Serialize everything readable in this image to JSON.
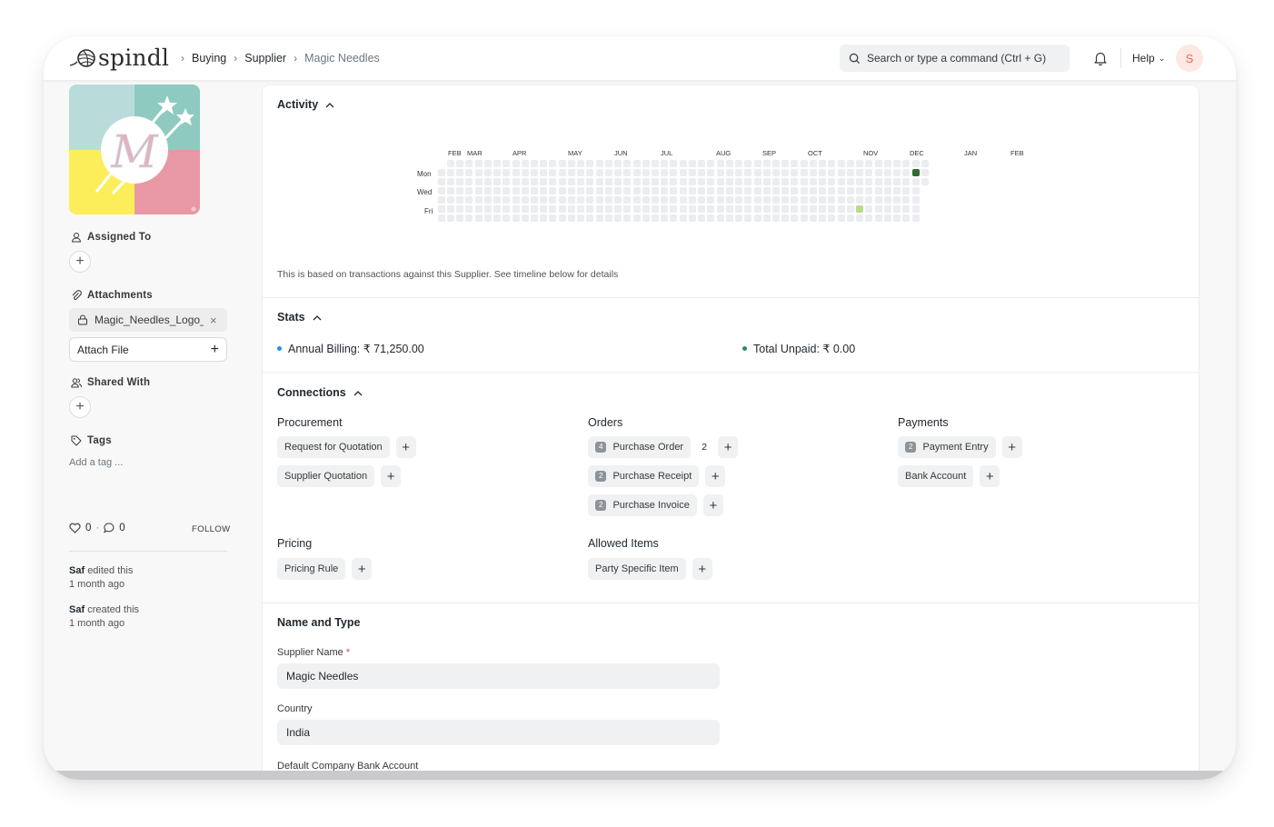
{
  "app": {
    "logo_text": "spindl"
  },
  "breadcrumb": {
    "items": [
      "Buying",
      "Supplier",
      "Magic Needles"
    ]
  },
  "search": {
    "placeholder": "Search or type a command (Ctrl + G)"
  },
  "nav": {
    "help_label": "Help",
    "avatar_letter": "S"
  },
  "sidebar": {
    "assigned_label": "Assigned To",
    "attachments_label": "Attachments",
    "attachment_file": "Magic_Needles_Logo_S",
    "attach_file_label": "Attach File",
    "shared_label": "Shared With",
    "tags_label": "Tags",
    "add_tag": "Add a tag ...",
    "likes": "0",
    "comments": "0",
    "follow": "FOLLOW",
    "timeline": [
      {
        "user": "Saf",
        "action": "edited this",
        "time": "1 month ago"
      },
      {
        "user": "Saf",
        "action": "created this",
        "time": "1 month ago"
      }
    ]
  },
  "activity": {
    "title": "Activity",
    "months": [
      "FEB",
      "MAR",
      "APR",
      "MAY",
      "JUN",
      "JUL",
      "AUG",
      "SEP",
      "OCT",
      "NOV",
      "DEC",
      "JAN",
      "FEB"
    ],
    "days": [
      "Mon",
      "Wed",
      "Fri"
    ],
    "note": "This is based on transactions against this Supplier. See timeline below for details",
    "active_cells": [
      {
        "week": 51,
        "day": 1,
        "level": "high"
      },
      {
        "week": 45,
        "day": 5,
        "level": "low"
      }
    ],
    "colors": {
      "empty": "#ebedf0",
      "high": "#2e6a30",
      "low": "#b6dc8c"
    }
  },
  "stats": {
    "title": "Stats",
    "annual_billing": "Annual Billing: ₹ 71,250.00",
    "total_unpaid": "Total Unpaid: ₹ 0.00",
    "billing_color": "#2490ef",
    "unpaid_color": "#2e8b57"
  },
  "connections": {
    "title": "Connections",
    "procurement": {
      "title": "Procurement",
      "items": [
        "Request for Quotation",
        "Supplier Quotation"
      ]
    },
    "orders": {
      "title": "Orders",
      "items": [
        {
          "label": "Purchase Order",
          "count": "4",
          "qty": "2"
        },
        {
          "label": "Purchase Receipt",
          "count": "2"
        },
        {
          "label": "Purchase Invoice",
          "count": "2"
        }
      ]
    },
    "payments": {
      "title": "Payments",
      "items": [
        {
          "label": "Payment Entry",
          "count": "2"
        },
        {
          "label": "Bank Account"
        }
      ]
    },
    "pricing": {
      "title": "Pricing",
      "items": [
        "Pricing Rule"
      ]
    },
    "allowed": {
      "title": "Allowed Items",
      "items": [
        "Party Specific Item"
      ]
    }
  },
  "name_type": {
    "title": "Name and Type",
    "supplier_name_label": "Supplier Name",
    "supplier_name_value": "Magic Needles",
    "country_label": "Country",
    "country_value": "India",
    "bank_label": "Default Company Bank Account"
  }
}
